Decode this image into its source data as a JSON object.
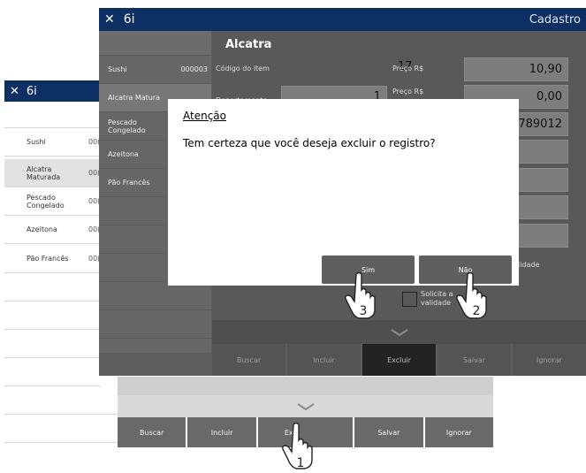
{
  "back_window": {
    "close_glyph": "✕",
    "app_name": "6i",
    "items": [
      {
        "label": "Sushi",
        "code": "00("
      },
      {
        "label": "Alcatra Maturada",
        "code": "00("
      },
      {
        "label": "Pescado Congelado",
        "code": "00("
      },
      {
        "label": "Azeitona",
        "code": "00("
      },
      {
        "label": "Pão Francês",
        "code": "00("
      }
    ],
    "buttons": [
      "Buscar",
      "Incluir",
      "Excluir",
      "Salvar",
      "Ignorar"
    ],
    "excluir_partial": "Exc"
  },
  "front_window": {
    "close_glyph": "✕",
    "app_name": "6i",
    "title_right": "Cadastro",
    "items": [
      {
        "label": "Sushi",
        "code": "000003"
      },
      {
        "label": "Alcatra Matura",
        "code": ""
      },
      {
        "label": "Pescado Congelado",
        "code": ""
      },
      {
        "label": "Azeitona",
        "code": ""
      },
      {
        "label": "Pão Francês",
        "code": ""
      }
    ],
    "heading": "Alcatra",
    "fields": {
      "codigo_label": "Código do item",
      "codigo_value": "17",
      "preco_label": "Preço R$",
      "preco_value": "10,90",
      "depto_label": "Departamento",
      "depto_value": "1",
      "preco2_label": "Preço R$",
      "preco2_value": "0,00",
      "barcode_partial": "56789012",
      "validade_partial": "lidade",
      "solicita_label": "Solicita a validade"
    },
    "buttons": [
      "Buscar",
      "Incluir",
      "Excluir",
      "Salvar",
      "Ignorar"
    ]
  },
  "dialog": {
    "title": "Atenção",
    "message": "Tem certeza que você deseja excluir o registro?",
    "yes_label": "Sim",
    "no_label": "Não"
  },
  "step_markers": {
    "excluir_back": "1",
    "nao": "2",
    "sim": "3"
  },
  "colors": {
    "title_bar": "#0d2f63",
    "dialog_bg": "#ffffff"
  }
}
